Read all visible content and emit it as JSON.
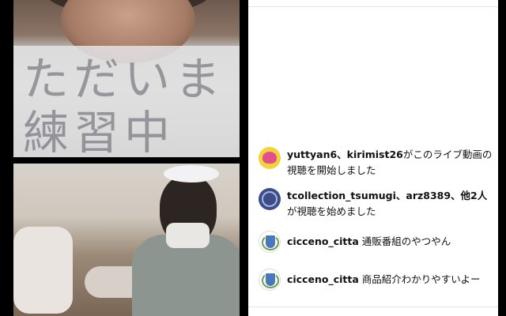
{
  "video": {
    "top_tile_sign_text": "ただいま\n練習中"
  },
  "comments": [
    {
      "username": "yuttyan6、kirimist26",
      "text": "がこのライブ動画の視聴を開始しました",
      "avatar_icon": "heart-avatar-icon"
    },
    {
      "username": "tcollection_tsumugi、arz8389、他2人",
      "text": "が視聴を始めました",
      "avatar_icon": "ring-avatar-icon"
    },
    {
      "username": "cicceno_citta",
      "text": "通販番組のやつやん",
      "avatar_icon": "crest-avatar-icon"
    },
    {
      "username": "cicceno_citta",
      "text": "商品紹介わかりやすいよー",
      "avatar_icon": "crest-avatar-icon"
    }
  ],
  "colors": {
    "panel_bg": "#ffffff",
    "background": "#000000",
    "text": "#111111",
    "divider": "#e3e3e3"
  }
}
